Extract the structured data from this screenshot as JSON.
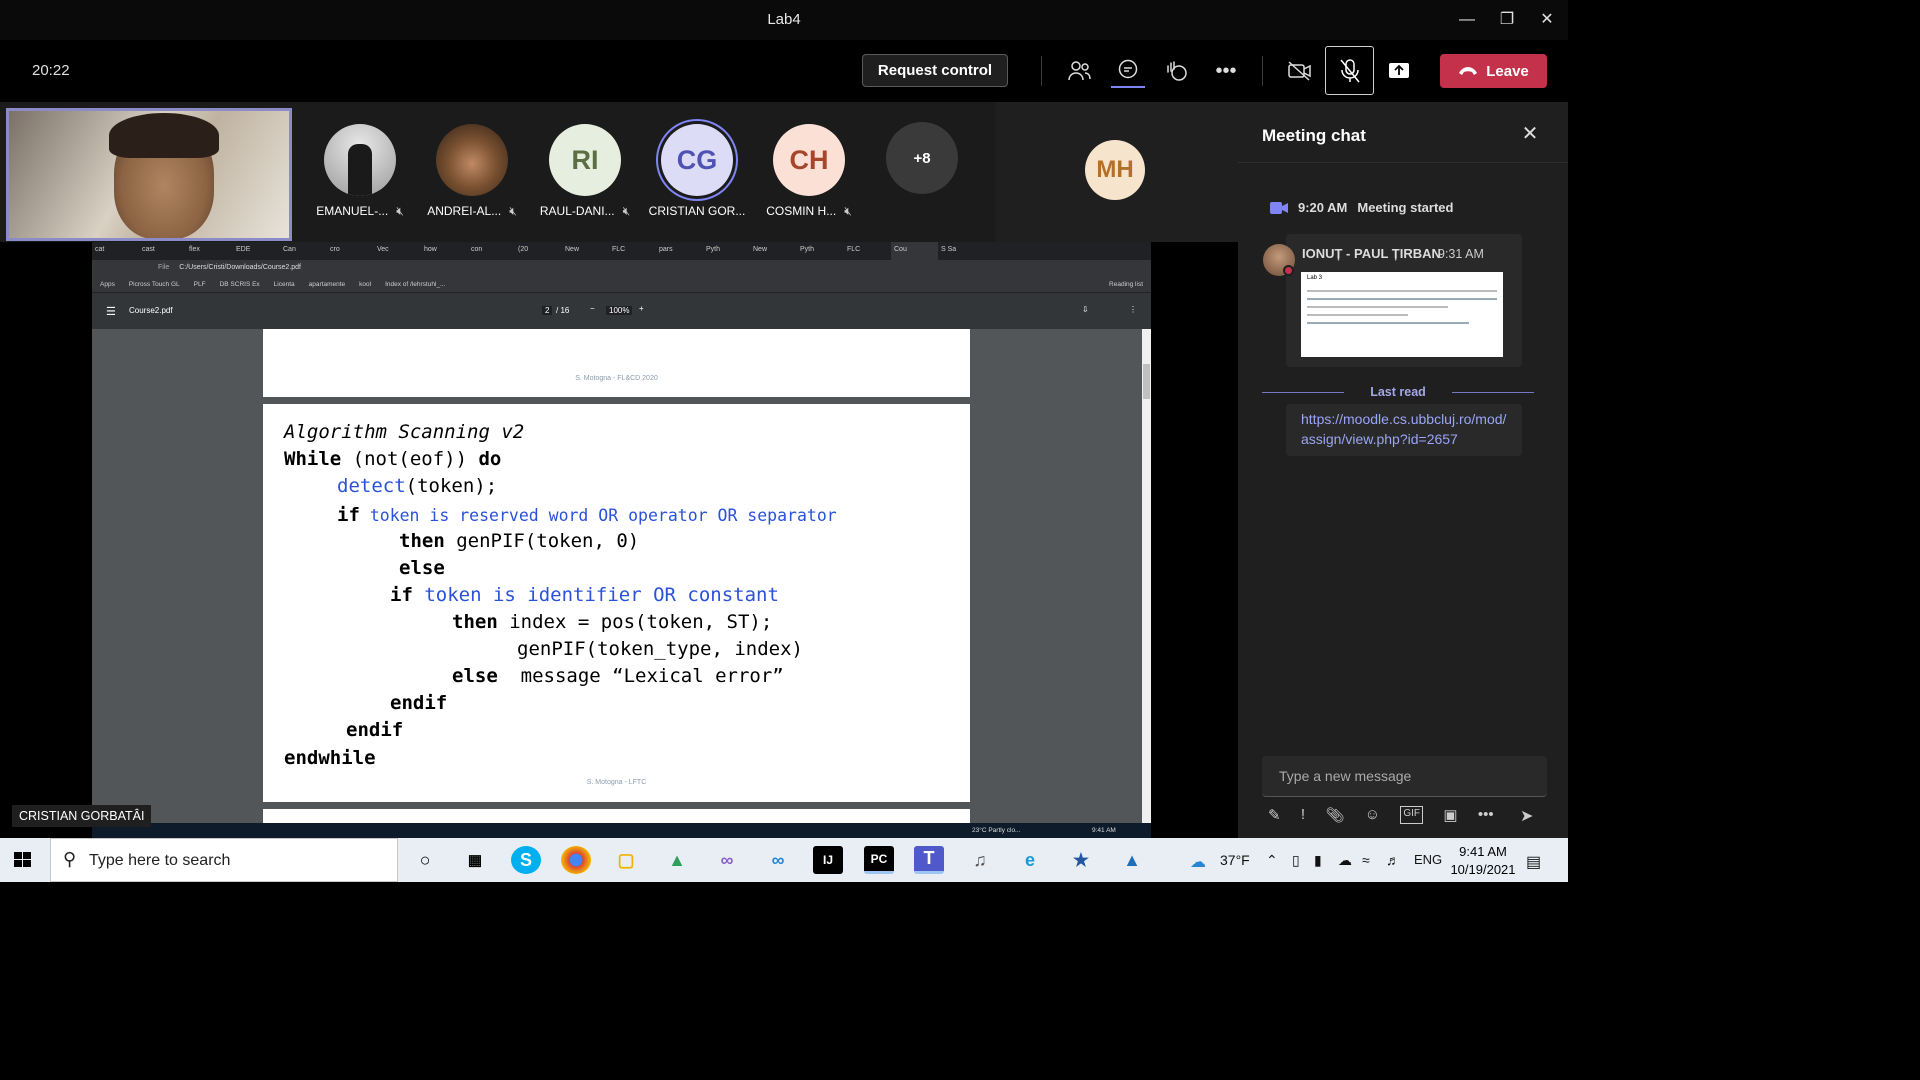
{
  "window": {
    "title": "Lab4"
  },
  "toolbar": {
    "time": "20:22",
    "request_control": "Request control",
    "leave": "Leave"
  },
  "participants": [
    {
      "label": "EMANUEL-...",
      "initials": "",
      "photo": true
    },
    {
      "label": "ANDREI-AL...",
      "initials": "",
      "photo": true
    },
    {
      "label": "RAUL-DANI...",
      "initials": "RI",
      "bg": "#e6eedf",
      "fg": "#5b6e44"
    },
    {
      "label": "CRISTIAN GOR...",
      "initials": "CG",
      "bg": "#dcdcf6",
      "fg": "#4f52b2"
    },
    {
      "label": "COSMIN H...",
      "initials": "CH",
      "bg": "#fbe0d6",
      "fg": "#a5472d"
    }
  ],
  "overflow_count": "+8",
  "spotlight": {
    "initials": "MH"
  },
  "shared": {
    "tabs": [
      "cat",
      "cast",
      "flex",
      "EDE",
      "Can",
      "cro",
      "Vec",
      "how",
      "con",
      "(20",
      "New",
      "FLC",
      "pars",
      "Pyth",
      "New",
      "Pyth",
      "FLC",
      "Cou",
      "S Sa"
    ],
    "address": "C:/Users/Cristi/Downloads/Course2.pdf",
    "address_prefix": "File",
    "bookmarks": [
      "Apps",
      "Picross Touch GL",
      "PLF",
      "DB SCRIS Ex",
      "Licenta",
      "apartamente",
      "kool",
      "Index of /lehrstuhl_..."
    ],
    "reading_list": "Reading list",
    "pdf_name": "Course2.pdf",
    "page_current": "2",
    "page_total": "/ 16",
    "zoom": "100%",
    "page1_footer": "S. Motogna - FL&CD 2020",
    "page2_footer": "S. Motogna - LFTC",
    "code": {
      "l1": "Algorithm Scanning v2",
      "l2a": "While",
      "l2b": " (not(eof)) ",
      "l2c": "do",
      "l3": "detect",
      "l3b": "(token);",
      "l4a": "if",
      "l4b": " token is reserved word OR operator OR separator",
      "l5a": "then",
      "l5b": " genPIF(token, 0)",
      "l6": "else",
      "l7a": "if",
      "l7b": " token is identifier OR constant",
      "l8a": "then",
      "l8b": " index = pos(token, ST);",
      "l9": "genPIF(token_type, index)",
      "l10a": "else",
      "l10b": "  message “Lexical error”",
      "l11": "endif",
      "l12": "endif",
      "l13": "endwhile"
    },
    "remote_tray": {
      "weather": "23°C  Partly clo...",
      "time": "9:41 AM"
    },
    "presenter_name": "CRISTIAN GORBATÂI"
  },
  "chat": {
    "title": "Meeting chat",
    "system_time": "9:20 AM",
    "system_text": "Meeting started",
    "sender": "IONUȚ - PAUL ȚIRBAN",
    "sender_time": "9:31 AM",
    "thumb_title": "Lab 3",
    "last_read": "Last read",
    "link": "https://moodle.cs.ubbcluj.ro/mod/assign/view.php?id=2657",
    "compose_placeholder": "Type a new message"
  },
  "taskbar": {
    "search_placeholder": "Type here to search",
    "temperature": "37°F",
    "language": "ENG",
    "time": "9:41 AM",
    "date": "10/19/2021"
  }
}
